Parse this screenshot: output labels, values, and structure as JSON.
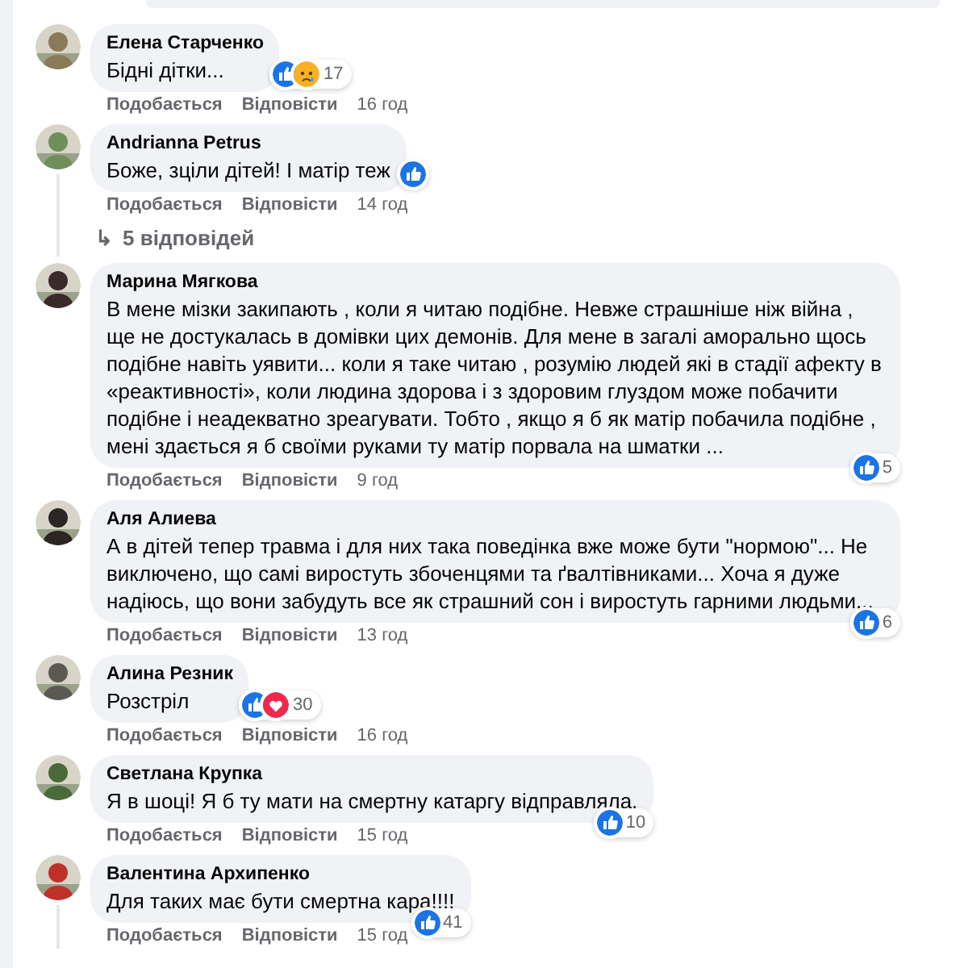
{
  "comments": [
    {
      "author": "Елена Старченко",
      "text": "Бідні дітки...",
      "reactions": {
        "icons": [
          {
            "kind": "like"
          },
          {
            "kind": "sad"
          }
        ],
        "count": "17",
        "beside_text": true
      },
      "actions": {
        "like": "Подобається",
        "reply": "Відповісти",
        "time": "16 год"
      },
      "thread_line": false
    },
    {
      "author": "Andrianna Petrus",
      "text": "Боже, зціли дітей! І матір теж",
      "reactions": {
        "icons": [
          {
            "kind": "like"
          }
        ],
        "beside_text": true
      },
      "actions": {
        "like": "Подобається",
        "reply": "Відповісти",
        "time": "14 год"
      },
      "thread_line": true,
      "replies": {
        "icon": "↳",
        "label": "5 відповідей"
      }
    },
    {
      "author": "Марина Мягкова",
      "text": "В мене мізки закипають , коли я читаю подібне. Невже страшніше ніж війна , ще не достукалась в домівки цих демонів. Для мене в загалі аморально щось подібне навіть уявити... коли я таке читаю , розумію людей які в стадії афекту в «реактивності», коли людина здорова і з здоровим глуздом може побачити подібне і неадекватно зреагувати. Тобто , якщо я б як матір побачила подібне , мені здається я б своїми руками ту матір порвала на шматки ...",
      "reactions": {
        "icons": [
          {
            "kind": "like"
          }
        ],
        "count": "5",
        "beside_text": false
      },
      "actions": {
        "like": "Подобається",
        "reply": "Відповісти",
        "time": "9 год"
      },
      "thread_line": false
    },
    {
      "author": "Аля Алиева",
      "text": "А в дітей тепер травма і для них така поведінка вже може бути \"нормою\"... Не виключено, що самі виростуть збоченцями та ґвалтівниками... Хоча я дуже надіюсь, що вони забудуть все як страшний сон і виростуть гарними людьми...",
      "reactions": {
        "icons": [
          {
            "kind": "like"
          }
        ],
        "count": "6",
        "beside_text": false
      },
      "actions": {
        "like": "Подобається",
        "reply": "Відповісти",
        "time": "13 год"
      },
      "thread_line": false
    },
    {
      "author": "Алина Резник",
      "text": "Розстріл",
      "reactions": {
        "icons": [
          {
            "kind": "like"
          },
          {
            "kind": "love"
          }
        ],
        "count": "30",
        "beside_text": true
      },
      "actions": {
        "like": "Подобається",
        "reply": "Відповісти",
        "time": "16 год"
      },
      "thread_line": false
    },
    {
      "author": "Светлана Крупка",
      "text": "Я в шоці! Я б ту мати на смертну катаргу відправляла.",
      "reactions": {
        "icons": [
          {
            "kind": "like"
          }
        ],
        "count": "10",
        "beside_text": false
      },
      "actions": {
        "like": "Подобається",
        "reply": "Відповісти",
        "time": "15 год"
      },
      "thread_line": false
    },
    {
      "author": "Валентина Архипенко",
      "text": "Для таких має бути смертна кара!!!!",
      "reactions": {
        "icons": [
          {
            "kind": "like"
          }
        ],
        "count": "41",
        "beside_text": false
      },
      "actions": {
        "like": "Подобається",
        "reply": "Відповісти",
        "time": "15 год"
      },
      "thread_line": true
    }
  ]
}
